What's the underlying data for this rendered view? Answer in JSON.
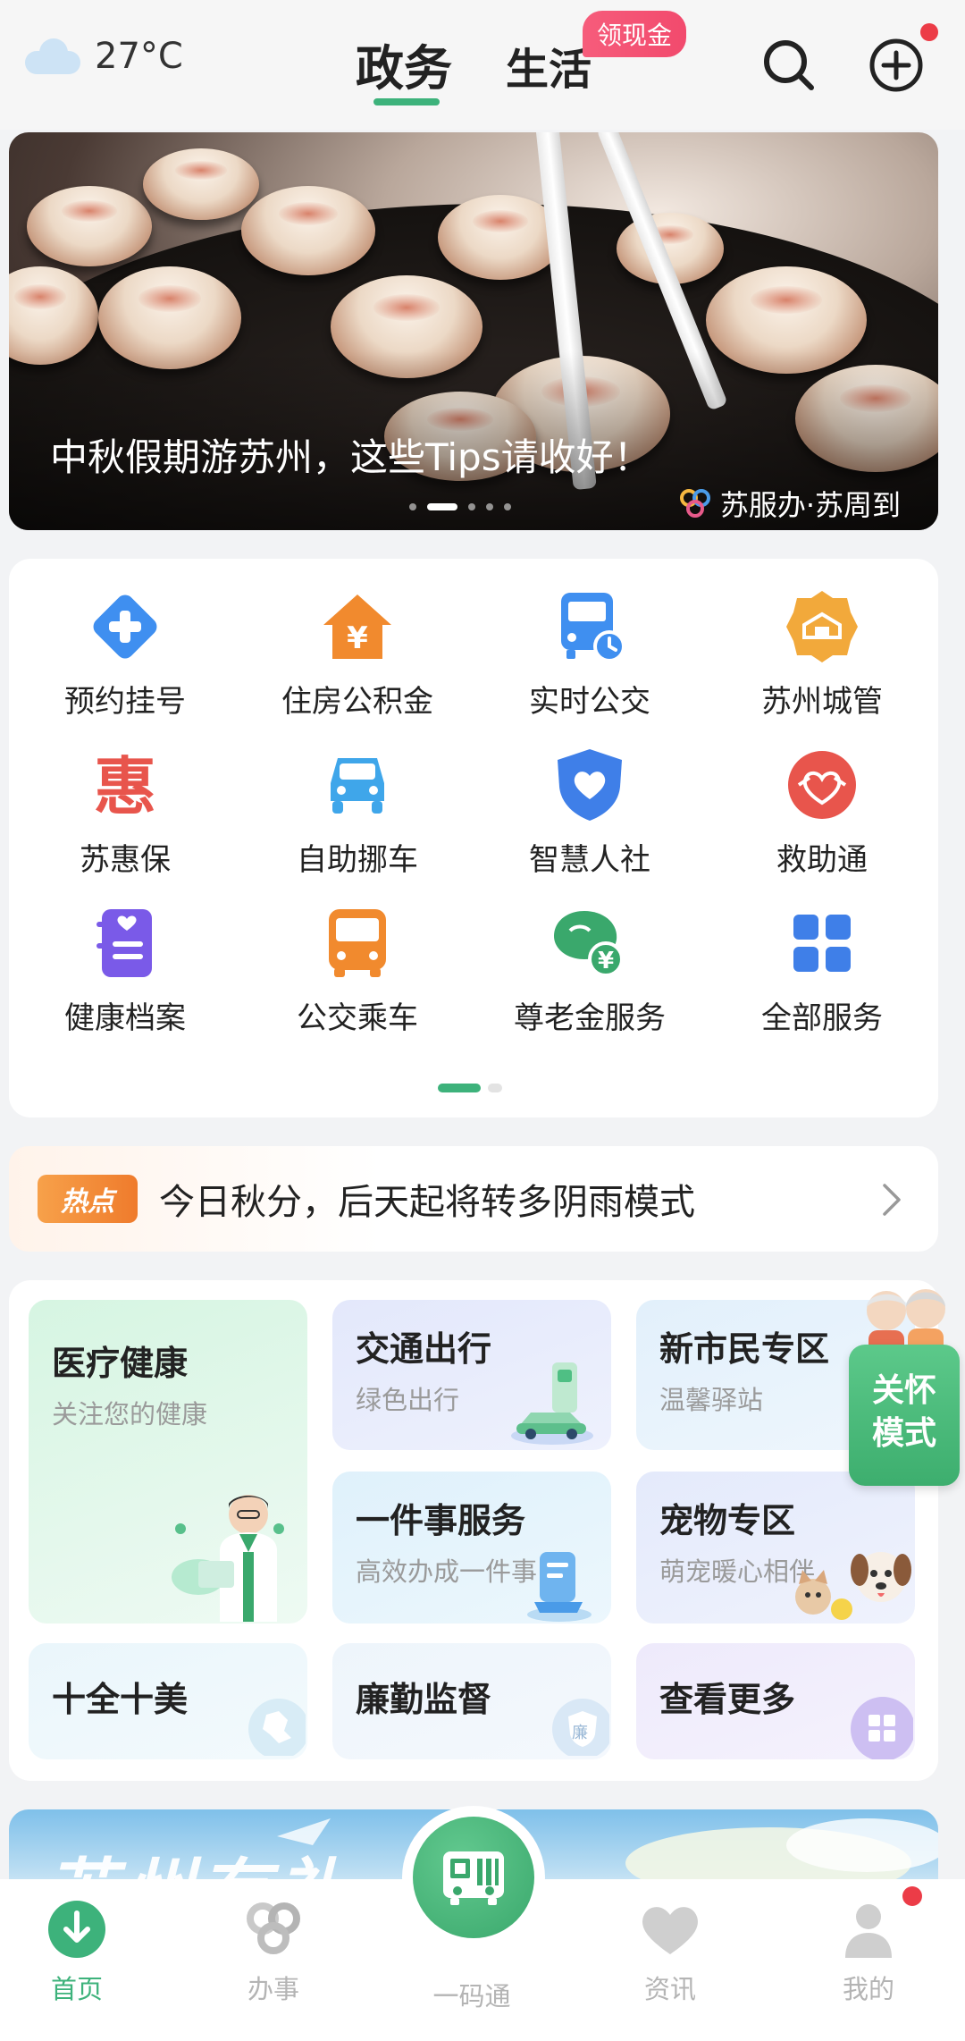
{
  "header": {
    "temperature": "27°C",
    "tabs": [
      "政务",
      "生活"
    ],
    "badge": "领现金"
  },
  "banner": {
    "title": "中秋假期游苏州，这些Tips请收好！",
    "source": "苏服办·苏周到",
    "dots_total": 5,
    "dots_active_index": 1
  },
  "services": {
    "items": [
      {
        "label": "预约挂号",
        "icon": "medical-cross-icon"
      },
      {
        "label": "住房公积金",
        "icon": "house-yuan-icon"
      },
      {
        "label": "实时公交",
        "icon": "bus-clock-icon"
      },
      {
        "label": "苏州城管",
        "icon": "city-badge-icon"
      },
      {
        "label": "苏惠保",
        "icon": "hui-character-icon"
      },
      {
        "label": "自助挪车",
        "icon": "car-icon"
      },
      {
        "label": "智慧人社",
        "icon": "shield-heart-icon"
      },
      {
        "label": "救助通",
        "icon": "handshake-heart-icon"
      },
      {
        "label": "健康档案",
        "icon": "health-record-icon"
      },
      {
        "label": "公交乘车",
        "icon": "bus-front-icon"
      },
      {
        "label": "尊老金服务",
        "icon": "elder-money-icon"
      },
      {
        "label": "全部服务",
        "icon": "grid-icon"
      }
    ],
    "pages": 2,
    "active_page": 0
  },
  "hot": {
    "tag": "热点",
    "text": "今日秋分，后天起将转多阴雨模式"
  },
  "features": {
    "medical": {
      "title": "医疗健康",
      "subtitle": "关注您的健康"
    },
    "traffic": {
      "title": "交通出行",
      "subtitle": "绿色出行"
    },
    "newres": {
      "title": "新市民专区",
      "subtitle": "温馨驿站"
    },
    "onething": {
      "title": "一件事服务",
      "subtitle": "高效办成一件事"
    },
    "pet": {
      "title": "宠物专区",
      "subtitle": "萌宠暖心相伴"
    },
    "ten": {
      "title": "十全十美"
    },
    "clean": {
      "title": "廉勤监督",
      "badge": "廉"
    },
    "more": {
      "title": "查看更多"
    }
  },
  "care_mode": {
    "label_line1": "关怀",
    "label_line2": "模式"
  },
  "promo": {
    "text": "苏州有礼"
  },
  "tabbar": {
    "home": "首页",
    "work": "办事",
    "code": "一码通",
    "news": "资讯",
    "mine": "我的"
  },
  "colors": {
    "accent_green": "#3db27b",
    "badge_red": "#f24a6d",
    "hot_orange": "#ef7b2c",
    "dot_red": "#ec3c47"
  }
}
